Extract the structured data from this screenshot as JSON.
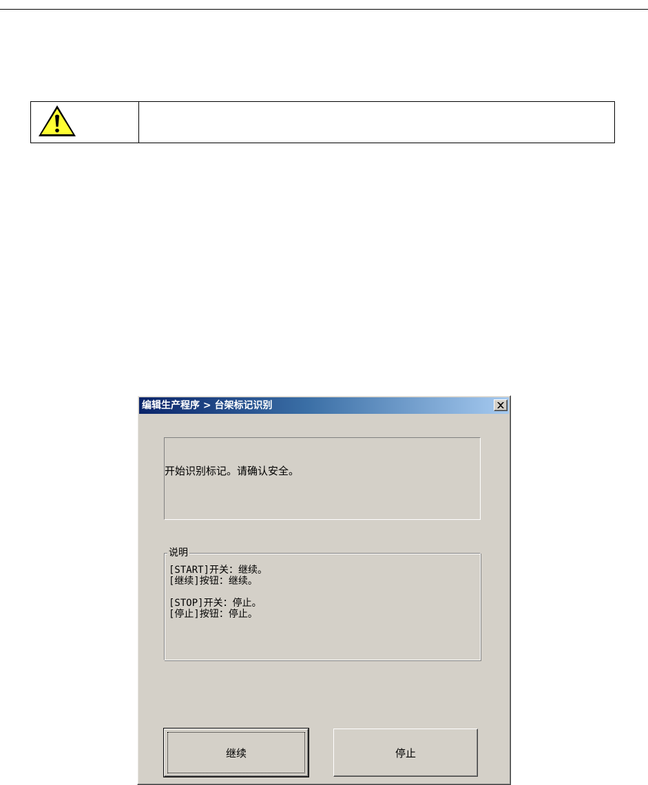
{
  "caution": {
    "icon": "warning-triangle-icon",
    "text": ""
  },
  "dialog": {
    "title": "编辑生产程序 > 台架标记识别",
    "close_icon": "close-icon",
    "message": "开始识别标记。请确认安全。",
    "description": {
      "legend": "说明",
      "lines": [
        "[START]开关：继续。",
        "[继续]按钮：继续。",
        "[STOP]开关：停止。",
        "[停止]按钮：停止。"
      ]
    },
    "buttons": {
      "continue_label": "继续",
      "stop_label": "停止"
    }
  }
}
